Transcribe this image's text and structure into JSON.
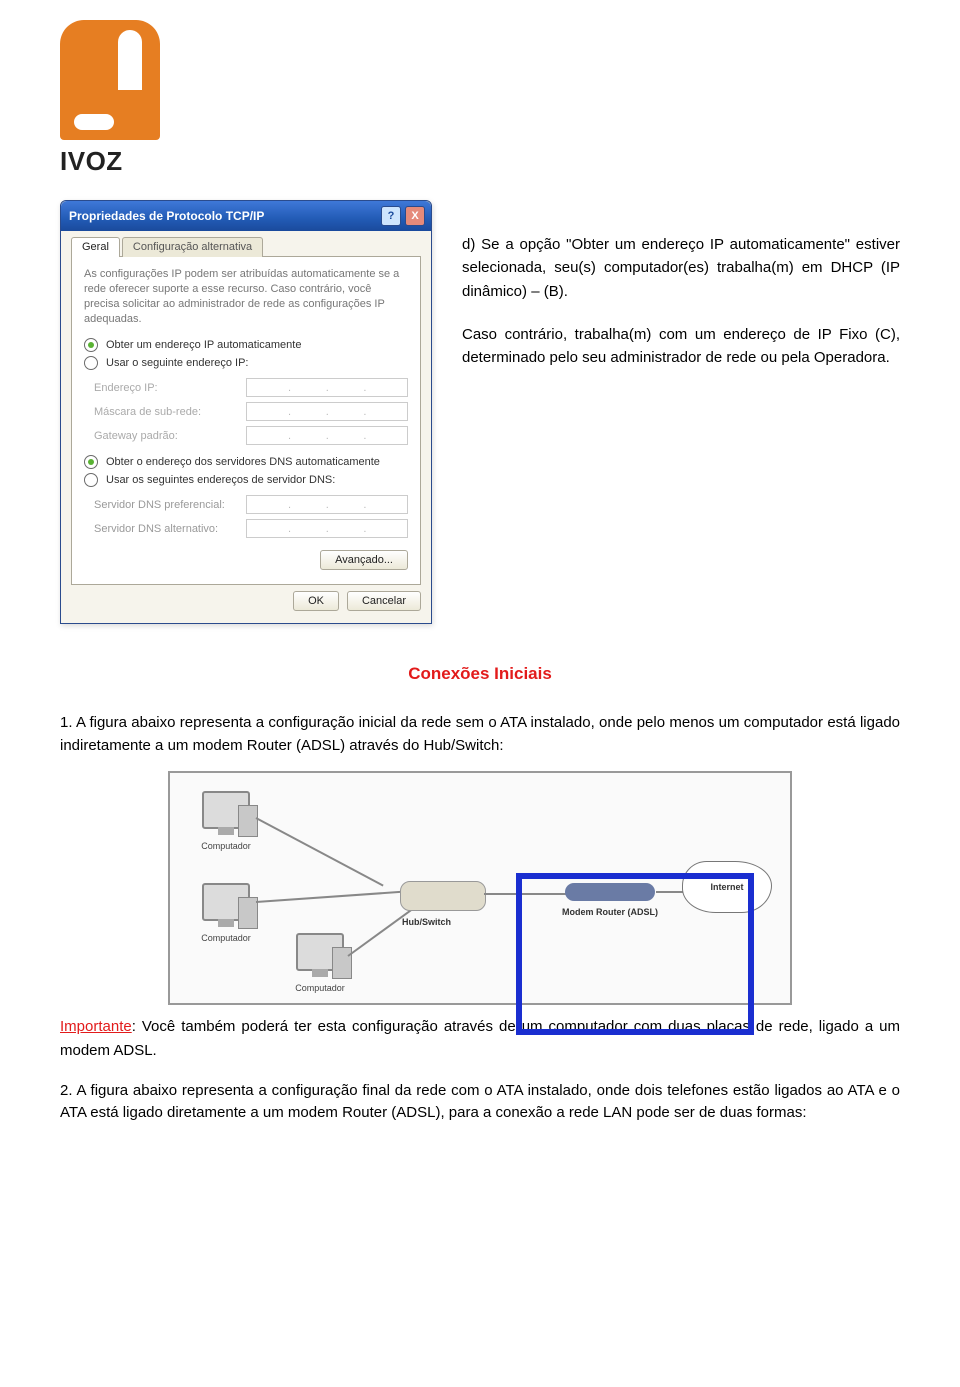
{
  "logo": {
    "text": "IVOZ"
  },
  "dialog": {
    "title": "Propriedades de Protocolo TCP/IP",
    "help_btn": "?",
    "close_btn": "X",
    "tab_active": "Geral",
    "tab_alt": "Configuração alternativa",
    "desc": "As configurações IP podem ser atribuídas automaticamente se a rede oferecer suporte a esse recurso. Caso contrário, você precisa solicitar ao administrador de rede as configurações IP adequadas.",
    "radio1": "Obter um endereço IP automaticamente",
    "radio2": "Usar o seguinte endereço IP:",
    "ip_label": "Endereço IP:",
    "mask_label": "Máscara de sub-rede:",
    "gw_label": "Gateway padrão:",
    "radio3": "Obter o endereço dos servidores DNS automaticamente",
    "radio4": "Usar os seguintes endereços de servidor DNS:",
    "dns1_label": "Servidor DNS preferencial:",
    "dns2_label": "Servidor DNS alternativo:",
    "btn_adv": "Avançado...",
    "btn_ok": "OK",
    "btn_cancel": "Cancelar"
  },
  "right": {
    "para1": "d) Se a opção \"Obter um endereço IP automaticamente\" estiver selecionada, seu(s) computador(es) trabalha(m) em DHCP (IP dinâmico) – (B).",
    "para2": "Caso contrário, trabalha(m) com um endereço de IP Fixo (C), determinado pelo seu administrador de rede ou pela Operadora."
  },
  "section_heading": "Conexões Iniciais",
  "item1": "1.  A figura abaixo representa a configuração inicial da rede sem o ATA instalado, onde pelo menos um computador está ligado indiretamente a um modem Router (ADSL) através do Hub/Switch:",
  "diagram": {
    "pc_label": "Computador",
    "hub_label": "Hub/Switch",
    "modem_label": "Modem Router (ADSL)",
    "internet_label": "Internet"
  },
  "importante": {
    "label": "Importante",
    "text": ": Você também poderá ter esta configuração através de um computador com duas placas de rede, ligado a um modem ADSL."
  },
  "item2": "2.  A figura abaixo representa a configuração final da rede com o ATA instalado, onde dois telefones estão ligados ao ATA e o ATA está ligado diretamente a um modem Router (ADSL), para a conexão a rede LAN pode ser de duas formas:"
}
